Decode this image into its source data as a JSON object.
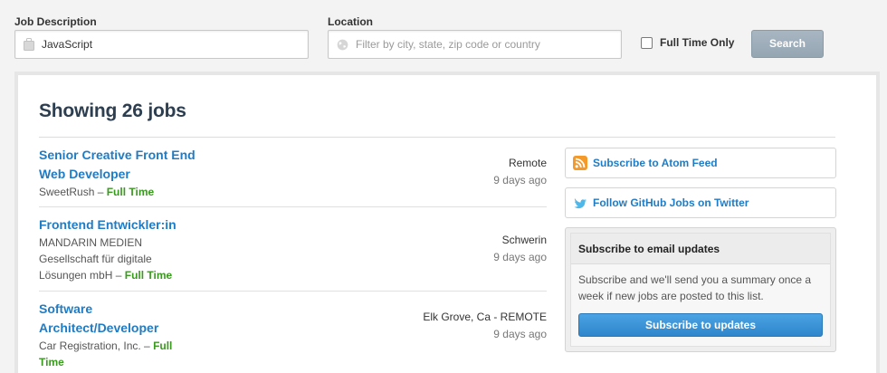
{
  "search": {
    "description_label": "Job Description",
    "description_value": "JavaScript",
    "location_label": "Location",
    "location_placeholder": "Filter by city, state, zip code or country",
    "full_time_label": "Full Time Only",
    "full_time_checked": false,
    "search_button": "Search"
  },
  "results": {
    "heading": "Showing 26 jobs",
    "jobs": [
      {
        "title_lines": [
          "Senior Creative Front End",
          "Web Developer"
        ],
        "company_lines": [
          "SweetRush"
        ],
        "separator": " – ",
        "type": "Full Time",
        "location": "Remote",
        "age": "9 days ago"
      },
      {
        "title_lines": [
          "Frontend Entwickler:in"
        ],
        "company_lines": [
          "MANDARIN MEDIEN",
          "Gesellschaft für digitale",
          "Lösungen mbH"
        ],
        "separator": " – ",
        "type": "Full Time",
        "location": "Schwerin",
        "age": "9 days ago"
      },
      {
        "title_lines": [
          "Software",
          "Architect/Developer"
        ],
        "company_lines": [
          "Car Registration, Inc."
        ],
        "separator": " – ",
        "type_lines": [
          "Full",
          "Time"
        ],
        "type": "Full Time",
        "location": "Elk Grove, Ca - REMOTE",
        "age": "9 days ago"
      }
    ]
  },
  "sidebar": {
    "atom_feed": "Subscribe to Atom Feed",
    "twitter": "Follow GitHub Jobs on Twitter",
    "email_heading": "Subscribe to email updates",
    "email_text_lines": [
      "Subscribe and we'll send you a summary once a",
      "week if new jobs are posted to this list."
    ],
    "subscribe_button": "Subscribe to updates"
  },
  "colors": {
    "link_blue": "#1f7cc4",
    "full_time_green": "#3a9a1f",
    "heading_navy": "#2c3e50",
    "search_button_gray": "#9eaebb",
    "subscribe_blue": "#3a93d6",
    "rss_orange": "#f39a2b",
    "twitter_blue": "#4fb8e8"
  },
  "icons": {
    "description_field": "briefcase-icon",
    "location_field": "globe-icon",
    "atom_feed": "rss-icon",
    "twitter": "twitter-bird-icon"
  }
}
